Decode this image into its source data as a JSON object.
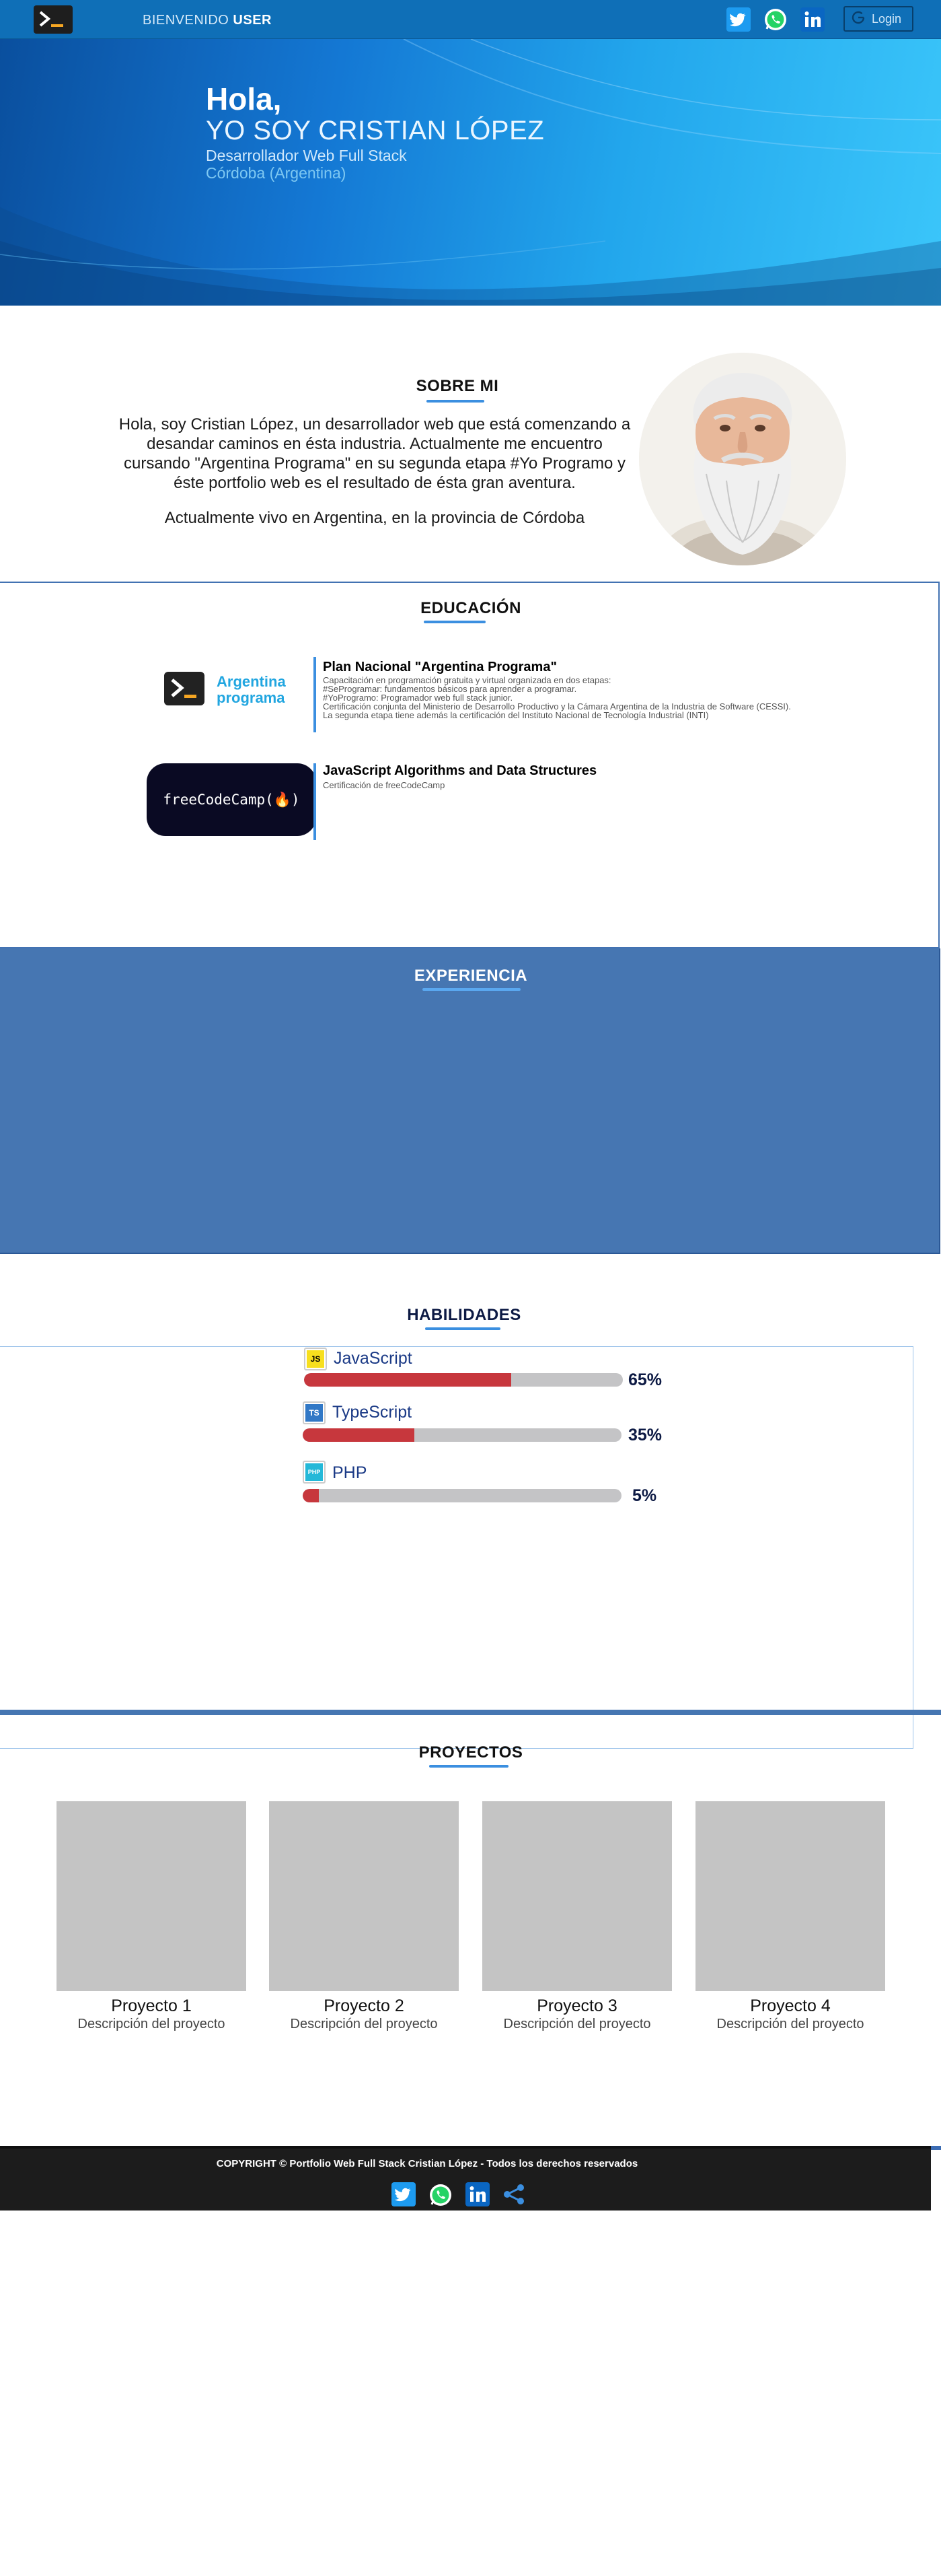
{
  "navbar": {
    "welcome_prefix": "BIENVENIDO",
    "welcome_user": "USER",
    "login_label": "Login",
    "icons": [
      "twitter-icon",
      "whatsapp-icon",
      "linkedin-icon"
    ]
  },
  "hero": {
    "greeting": "Hola,",
    "name": "YO SOY CRISTIAN LÓPEZ",
    "role": "Desarrollador Web Full Stack",
    "location": "Córdoba (Argentina)"
  },
  "about": {
    "title": "SOBRE MI",
    "paragraph1": "Hola, soy Cristian López, un desarrollador web que está comenzando a desandar caminos en ésta industria. Actualmente me encuentro cursando \"Argentina Programa\" en su segunda etapa #Yo Programo y éste portfolio web es el resultado de ésta gran aventura.",
    "paragraph2": "Actualmente vivo en Argentina, en la provincia de Córdoba"
  },
  "education": {
    "title": "EDUCACIÓN",
    "items": [
      {
        "logo_text_line1": "Argentina",
        "logo_text_line2": "programa",
        "title": "Plan Nacional \"Argentina Programa\"",
        "lines": [
          "Capacitación en programación gratuita y virtual organizada en dos etapas:",
          "#SeProgramar:  fundamentos básicos para aprender a programar.",
          "#YoProgramo: Programador web full stack junior.",
          "Certificación conjunta del Ministerio de Desarrollo Productivo y la Cámara Argentina de la Industria de Software (CESSI).",
          "La segunda etapa tiene además la certificación del Instituto Nacional de Tecnología Industrial (INTI)"
        ]
      },
      {
        "logo_text": "freeCodeCamp(🔥)",
        "title": "JavaScript Algorithms and Data Structures",
        "lines": [
          "Certificación de freeCodeCamp"
        ]
      }
    ]
  },
  "experience": {
    "title": "EXPERIENCIA"
  },
  "skills": {
    "title": "HABILIDADES",
    "items": [
      {
        "name": "JavaScript",
        "badge": "JS",
        "percent": 65,
        "label": "65%",
        "badge_bg": "#f7df1e",
        "badge_fg": "#000000"
      },
      {
        "name": "TypeScript",
        "badge": "TS",
        "percent": 35,
        "label": "35%",
        "badge_bg": "#3178c6",
        "badge_fg": "#ffffff"
      },
      {
        "name": "PHP",
        "badge": "PHP",
        "percent": 5,
        "label": "5%",
        "badge_bg": "#24b8d8",
        "badge_fg": "#ffffff"
      }
    ]
  },
  "projects": {
    "title": "PROYECTOS",
    "items": [
      {
        "name": "Proyecto 1",
        "desc": "Descripción del proyecto"
      },
      {
        "name": "Proyecto 2",
        "desc": "Descripción del proyecto"
      },
      {
        "name": "Proyecto 3",
        "desc": "Descripción del proyecto"
      },
      {
        "name": "Proyecto 4",
        "desc": "Descripción del proyecto"
      }
    ]
  },
  "footer": {
    "copyright": "COPYRIGHT © Portfolio Web Full Stack Cristian López - Todos los derechos reservados",
    "icons": [
      "twitter-icon",
      "whatsapp-icon",
      "linkedin-icon",
      "share-icon"
    ]
  },
  "colors": {
    "navbar": "#0f6fb7",
    "accent": "#3b8fe0",
    "experience_bg": "#4676b2",
    "bar_fill": "#c7373d",
    "bar_track": "#c4c4c6"
  }
}
